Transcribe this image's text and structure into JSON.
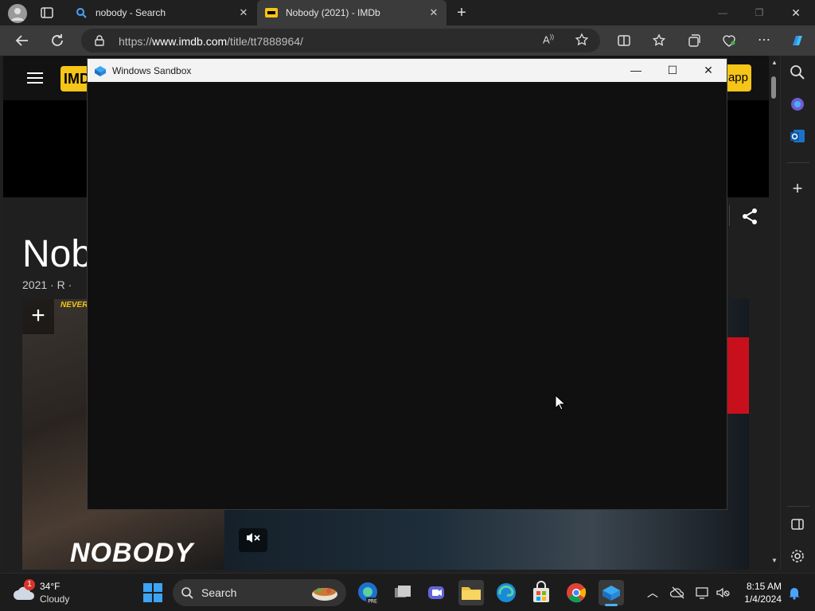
{
  "browser": {
    "tabs": [
      {
        "title": "nobody - Search"
      },
      {
        "title": "Nobody (2021) - IMDb"
      }
    ],
    "new_tab_label": "+",
    "url_prefix": "https://",
    "url_domain": "www.imdb.com",
    "url_path": "/title/tt7888964/"
  },
  "imdb": {
    "logo": "IMDb",
    "app_button": "app",
    "movie_title": "Nob",
    "movie_meta": "2021 · R · ",
    "poster_tagline": "NEVER",
    "poster_title": "NOBODY",
    "add_label": "+"
  },
  "sandbox": {
    "title": "Windows Sandbox"
  },
  "taskbar": {
    "weather_temp": "34°F",
    "weather_cond": "Cloudy",
    "weather_badge": "1",
    "search_label": "Search",
    "time": "8:15 AM",
    "date": "1/4/2024"
  }
}
